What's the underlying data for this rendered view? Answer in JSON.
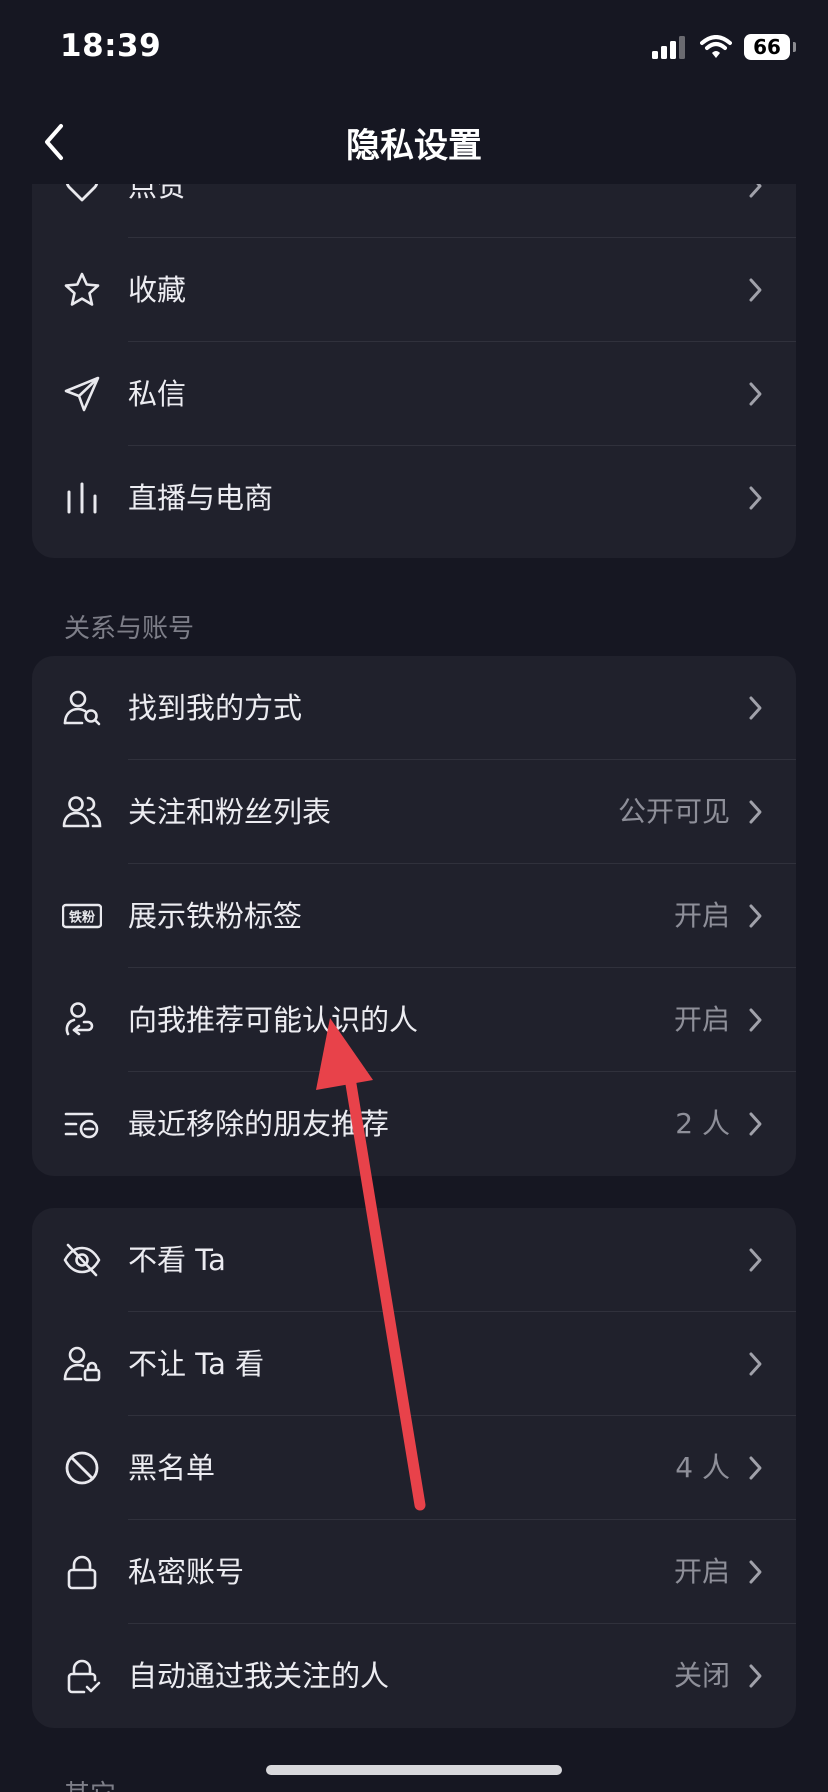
{
  "status": {
    "time": "18:39",
    "battery": "66"
  },
  "nav": {
    "title": "隐私设置",
    "back_icon": "chevron-left-icon"
  },
  "card1": {
    "items": [
      {
        "label": "点赞",
        "icon": "heart-icon"
      },
      {
        "label": "收藏",
        "icon": "star-icon"
      },
      {
        "label": "私信",
        "icon": "paper-plane-icon"
      },
      {
        "label": "直播与电商",
        "icon": "bar-chart-icon"
      }
    ]
  },
  "section_relations": {
    "title": "关系与账号",
    "items": [
      {
        "label": "找到我的方式",
        "value": "",
        "icon": "person-search-icon"
      },
      {
        "label": "关注和粉丝列表",
        "value": "公开可见",
        "icon": "people-icon"
      },
      {
        "label": "展示铁粉标签",
        "value": "开启",
        "icon": "iron-fan-badge-icon",
        "badge_text": "铁粉"
      },
      {
        "label": "向我推荐可能认识的人",
        "value": "开启",
        "icon": "person-link-icon"
      },
      {
        "label": "最近移除的朋友推荐",
        "value": "2 人",
        "icon": "list-remove-icon"
      }
    ]
  },
  "card3": {
    "items": [
      {
        "label": "不看 Ta",
        "value": "",
        "icon": "eye-off-icon"
      },
      {
        "label": "不让 Ta 看",
        "value": "",
        "icon": "person-lock-icon"
      },
      {
        "label": "黑名单",
        "value": "4 人",
        "icon": "block-icon"
      },
      {
        "label": "私密账号",
        "value": "开启",
        "icon": "lock-icon"
      },
      {
        "label": "自动通过我关注的人",
        "value": "关闭",
        "icon": "lock-check-icon"
      }
    ]
  },
  "section_other": {
    "title": "其它"
  },
  "colors": {
    "background": "#161722",
    "card": "#20212c",
    "arrow": "#e8424a"
  }
}
